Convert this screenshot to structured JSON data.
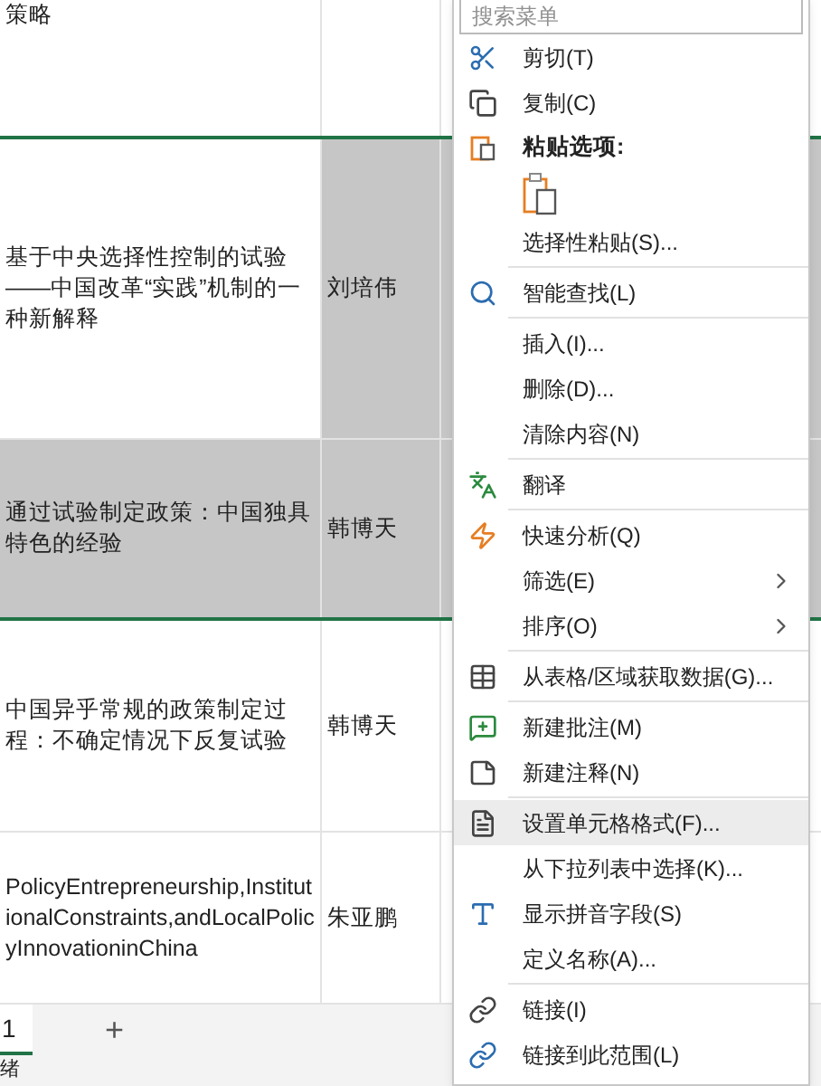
{
  "sheet": {
    "rows": [
      {
        "cells": [
          {
            "text": "策略",
            "selected": false
          },
          {
            "text": "",
            "selected": false
          }
        ],
        "kind": "top"
      },
      {
        "cells": [
          {
            "text": "基于中央选择性控制的试验——中国改革“实践”机制的一种新解释",
            "selected": false
          },
          {
            "text": "刘培伟",
            "selected": true
          }
        ],
        "kind": "normal"
      },
      {
        "cells": [
          {
            "text": "通过试验制定政策：中国独具特色的经验",
            "selected": true
          },
          {
            "text": "韩博天",
            "selected": true
          }
        ],
        "kind": "normal"
      },
      {
        "cells": [
          {
            "text": "中国异乎常规的政策制定过程：不确定情况下反复试验",
            "selected": false
          },
          {
            "text": "韩博天",
            "selected": false
          }
        ],
        "kind": "normal"
      },
      {
        "cells": [
          {
            "text": "PolicyEntrepreneurship,InstitutionalConstraints,andLocalPolicyInnovationinChina",
            "selected": false
          },
          {
            "text": "朱亚鹏",
            "selected": false
          }
        ],
        "kind": "normal"
      }
    ]
  },
  "sheet_tabs": [
    {
      "label": "1",
      "selected": true
    },
    {
      "label": "+",
      "selected": false
    }
  ],
  "status_bar": "绪",
  "context_menu": {
    "search": {
      "placeholder": "搜索菜单"
    },
    "items": [
      {
        "kind": "item",
        "label": "剪切(T)"
      },
      {
        "kind": "item",
        "label": "复制(C)"
      },
      {
        "kind": "header",
        "label": "粘贴选项:"
      },
      {
        "kind": "paste_icons"
      },
      {
        "kind": "item",
        "label": "选择性粘贴(S)..."
      },
      {
        "kind": "separator"
      },
      {
        "kind": "item",
        "label": "智能查找(L)"
      },
      {
        "kind": "separator"
      },
      {
        "kind": "item",
        "label": "插入(I)..."
      },
      {
        "kind": "item",
        "label": "删除(D)..."
      },
      {
        "kind": "item",
        "label": "清除内容(N)"
      },
      {
        "kind": "separator"
      },
      {
        "kind": "item",
        "label": "翻译"
      },
      {
        "kind": "separator"
      },
      {
        "kind": "item",
        "label": "快速分析(Q)"
      },
      {
        "kind": "item",
        "label": "筛选(E)",
        "submenu": true
      },
      {
        "kind": "item",
        "label": "排序(O)",
        "submenu": true
      },
      {
        "kind": "separator"
      },
      {
        "kind": "item",
        "label": "从表格/区域获取数据(G)..."
      },
      {
        "kind": "separator"
      },
      {
        "kind": "item",
        "label": "新建批注(M)"
      },
      {
        "kind": "item",
        "label": "新建注释(N)"
      },
      {
        "kind": "separator"
      },
      {
        "kind": "item",
        "label": "设置单元格格式(F)...",
        "hovered": true
      },
      {
        "kind": "item",
        "label": "从下拉列表中选择(K)..."
      },
      {
        "kind": "item",
        "label": "显示拼音字段(S)"
      },
      {
        "kind": "item",
        "label": "定义名称(A)..."
      },
      {
        "kind": "separator"
      },
      {
        "kind": "item",
        "label": "链接(I)"
      },
      {
        "kind": "item",
        "label": "链接到此范围(L)"
      }
    ]
  }
}
